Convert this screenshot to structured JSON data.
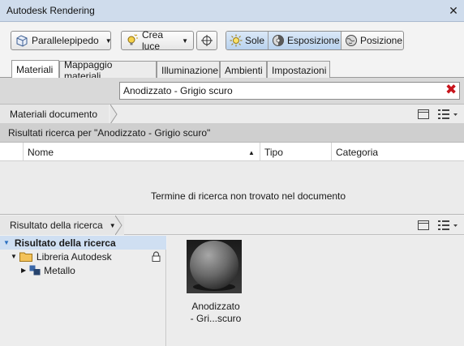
{
  "window": {
    "title": "Autodesk Rendering",
    "close_glyph": "✕"
  },
  "toolbar": {
    "parallelepiped": "Parallelepipedo",
    "create_light": "Crea luce",
    "sun": "Sole",
    "exposure": "Esposizione",
    "position": "Posizione"
  },
  "tabs": [
    {
      "label": "Materiali",
      "selected": true
    },
    {
      "label": "Mappaggio materiali",
      "selected": false
    },
    {
      "label": "Illuminazione",
      "selected": false
    },
    {
      "label": "Ambienti",
      "selected": false
    },
    {
      "label": "Impostazioni",
      "selected": false
    }
  ],
  "search": {
    "value": "Anodizzato - Grigio scuro",
    "clear_glyph": "✖"
  },
  "document_section": {
    "title": "Materiali documento"
  },
  "results": {
    "label": "Risultati ricerca per \"Anodizzato - Grigio scuro\"",
    "columns": [
      "Nome",
      "Tipo",
      "Categoria"
    ],
    "sort_glyph": "▲",
    "empty_message": "Termine di ricerca non trovato nel documento"
  },
  "search_result_section": {
    "title": "Risultato della ricerca"
  },
  "tree": {
    "root": "Risultato della ricerca",
    "library": "Libreria Autodesk",
    "child": "Metallo"
  },
  "material": {
    "name_line1": "Anodizzato",
    "name_line2": "- Gri...scuro"
  },
  "colors": {
    "accent": "#cfdcec",
    "clear_icon": "#c8141c",
    "tree_selected": "#cfdff2"
  }
}
